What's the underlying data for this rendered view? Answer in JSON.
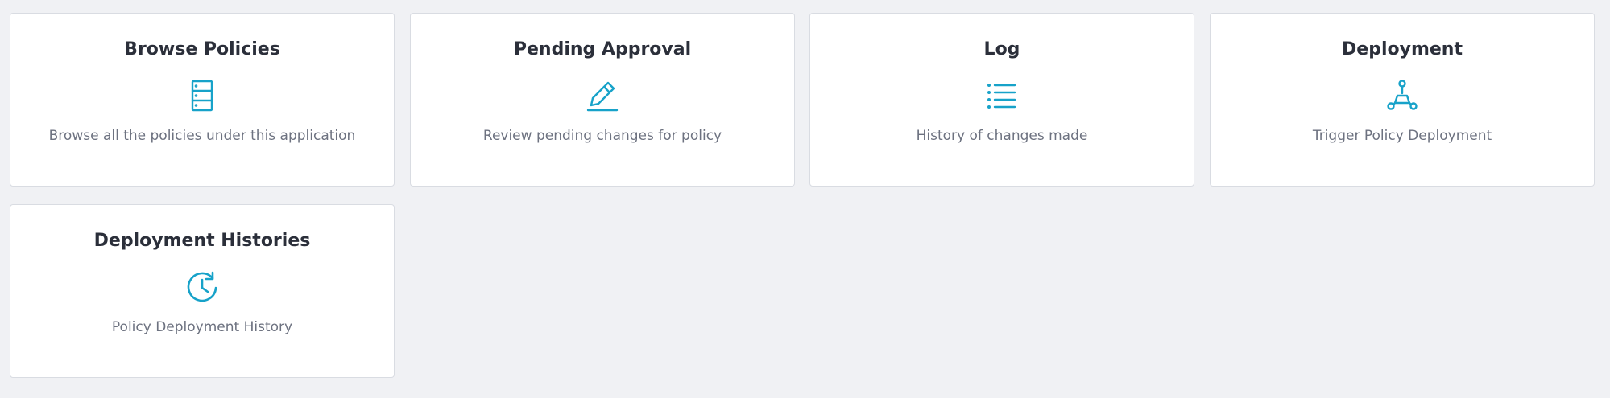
{
  "colors": {
    "accent": "#17a2c9",
    "background": "#f0f1f4",
    "card": "#ffffff",
    "title": "#2b2f3a",
    "description": "#6d7280"
  },
  "cards": [
    {
      "title": "Browse Policies",
      "description": "Browse all the policies under this application",
      "icon": "server-icon"
    },
    {
      "title": "Pending Approval",
      "description": "Review pending changes for policy",
      "icon": "pencil-icon"
    },
    {
      "title": "Log",
      "description": "History of changes made",
      "icon": "list-icon"
    },
    {
      "title": "Deployment",
      "description": "Trigger Policy Deployment",
      "icon": "network-icon"
    },
    {
      "title": "Deployment Histories",
      "description": "Policy Deployment History",
      "icon": "clock-history-icon"
    }
  ]
}
